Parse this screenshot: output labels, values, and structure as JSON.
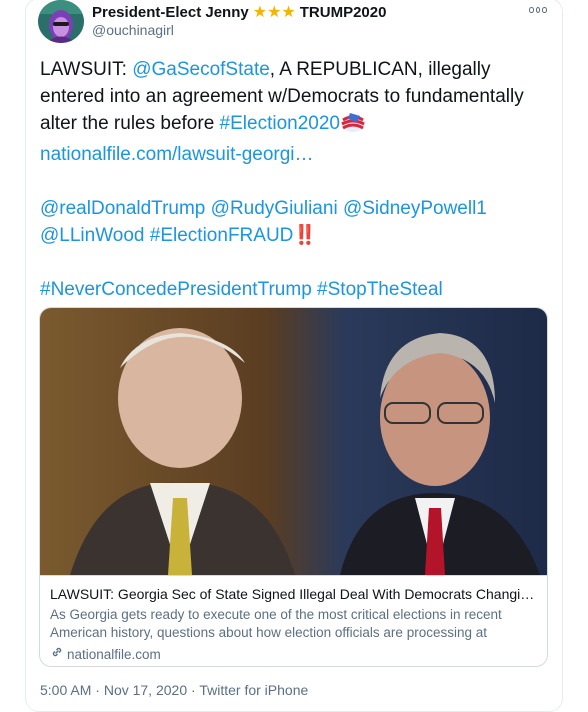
{
  "author": {
    "display_name": "President-Elect Jenny",
    "stars": "★★★",
    "name_suffix": "TRUMP2020",
    "handle": "@ouchinagirl"
  },
  "tweet": {
    "line1_prefix": "LAWSUIT: ",
    "mention_state": "@GaSecofState",
    "line1_rest": ", A REPUBLICAN, illegally entered into an agreement w/Democrats to fundamentally alter the rules before ",
    "hashtag_election": "#Election2020",
    "link_display": "nationalfile.com/lawsuit-georgi…",
    "mentions": [
      "@realDonaldTrump",
      "@RudyGiuliani",
      "@SidneyPowell1",
      "@LLinWood"
    ],
    "hashtag_fraud": "#ElectionFRAUD",
    "fraud_emoji": "‼️",
    "hashtags_end": [
      "#NeverConcedePresidentTrump",
      "#StopTheSteal"
    ]
  },
  "card": {
    "title": "LAWSUIT: Georgia Sec of State Signed Illegal Deal With Democrats Changi…",
    "description": "As Georgia gets ready to execute one of the most critical elections in recent American history, questions about how election officials are processing at",
    "domain": "nationalfile.com"
  },
  "meta": {
    "time": "5:00 AM",
    "sep1": " · ",
    "date": "Nov 17, 2020",
    "sep2": " · ",
    "source": "Twitter for iPhone"
  },
  "colors": {
    "link": "#1b95e0",
    "secondary_text": "#5b7083",
    "star": "#f4b400",
    "border": "#e6ecf0"
  }
}
